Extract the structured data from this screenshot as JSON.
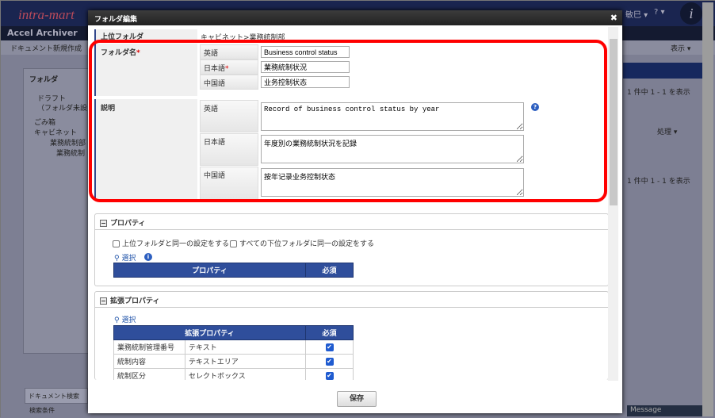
{
  "background": {
    "logo": "intra-mart",
    "user": "敏巳 ▾",
    "help": "? ▾",
    "app_title": "Accel Archiver",
    "new_doc": "ドキュメント新規作成",
    "view": "表示 ▾",
    "folder_title": "フォルダ",
    "tree": [
      "ドラフト",
      "（フォルダ未設",
      "ごみ箱",
      "キャビネット",
      "業務統制部",
      "業務統制"
    ],
    "count1": "1 件中 1 - 1 を表示",
    "process": "処理 ▾",
    "count2": "1 件中 1 - 1 を表示",
    "search_tab": "ドキュメント検索",
    "search_cond": "検索条件",
    "message": "Message"
  },
  "modal": {
    "title": "フォルダ編集",
    "close": "✖",
    "parent_label": "上位フォルダ",
    "parent_value": "キャビネット>業務統制部",
    "name_label": "フォルダ名",
    "required_mark": "*",
    "lang": {
      "en": "英語",
      "ja": "日本語",
      "zh": "中国語"
    },
    "name": {
      "en": "Business control status",
      "ja": "業務統制状況",
      "zh": "业务控制状态"
    },
    "desc_label": "説明",
    "desc": {
      "en": "Record of business control status by year",
      "ja": "年度別の業務統制状況を記録",
      "zh": "按年记录业务控制状态"
    },
    "help_icon": "?",
    "properties": {
      "title": "プロパティ",
      "same_as_parent": "上位フォルダと同一の設定をする",
      "apply_children": "すべての下位フォルダに同一の設定をする",
      "select": "選択",
      "info": "i",
      "col_property": "プロパティ",
      "col_required": "必須"
    },
    "ext_properties": {
      "title": "拡張プロパティ",
      "select": "選択",
      "col_property": "拡張プロパティ",
      "col_required": "必須",
      "rows": [
        {
          "name": "業務統制管理番号",
          "type": "テキスト",
          "required": true
        },
        {
          "name": "統制内容",
          "type": "テキストエリア",
          "required": true
        },
        {
          "name": "統制区分",
          "type": "セレクトボックス",
          "required": true
        }
      ]
    },
    "save": "保存"
  }
}
